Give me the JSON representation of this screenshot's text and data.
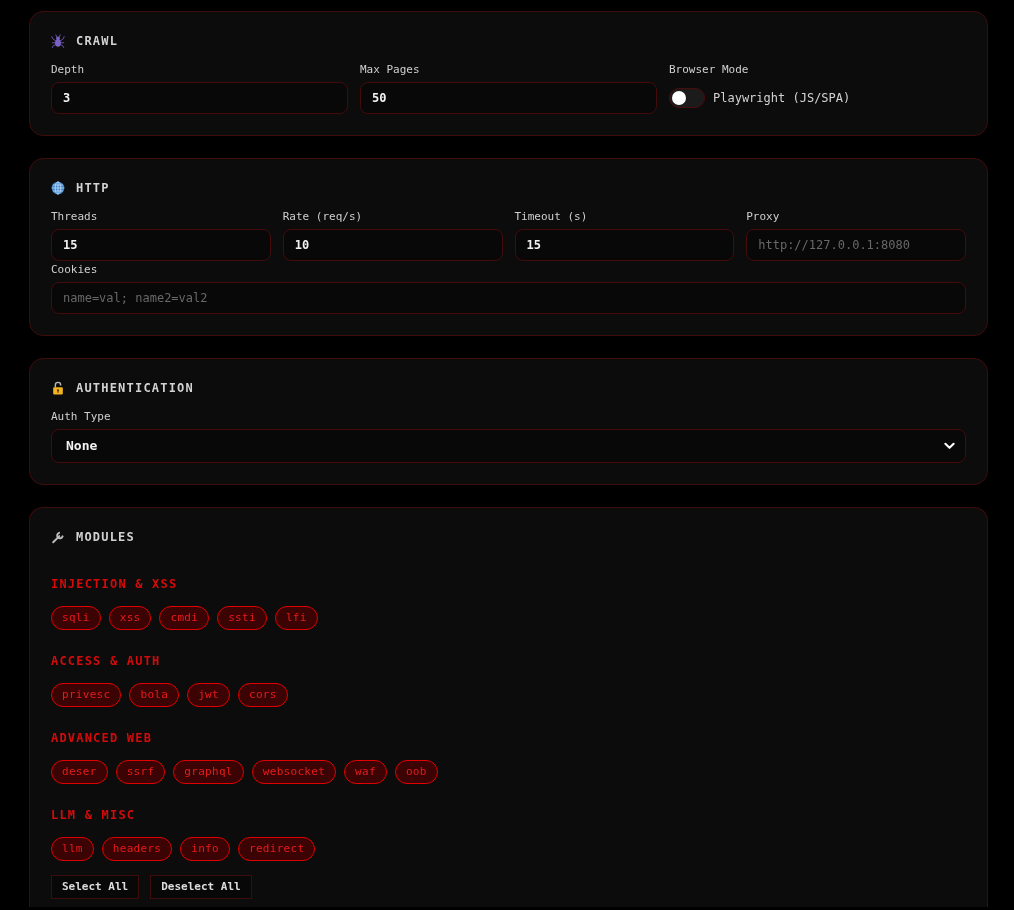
{
  "sections": [
    {
      "title": "CRAWL",
      "rows": [
        [
          {
            "kind": "input",
            "label": "Depth",
            "value": "3"
          },
          {
            "kind": "input",
            "label": "Max Pages",
            "value": "50"
          },
          {
            "kind": "toggle",
            "label": "Browser Mode",
            "text": "Playwright (JS/SPA)",
            "on": false
          }
        ]
      ]
    },
    {
      "title": "HTTP",
      "rows": [
        [
          {
            "kind": "input",
            "label": "Threads",
            "value": "15"
          },
          {
            "kind": "input",
            "label": "Rate (req/s)",
            "value": "10"
          },
          {
            "kind": "input",
            "label": "Timeout (s)",
            "value": "15"
          },
          {
            "kind": "input",
            "label": "Proxy",
            "placeholder": "http://127.0.0.1:8080"
          }
        ],
        [
          {
            "kind": "input",
            "label": "Cookies",
            "placeholder": "name=val; name2=val2"
          }
        ]
      ]
    },
    {
      "title": "AUTHENTICATION",
      "rows": [
        [
          {
            "kind": "select",
            "label": "Auth Type",
            "value": "None"
          }
        ]
      ]
    },
    {
      "title": "MODULES",
      "groups": [
        {
          "heading": "INJECTION & XSS",
          "modules": [
            {
              "label": "sqli",
              "selected": true
            },
            {
              "label": "xss",
              "selected": true
            },
            {
              "label": "cmdi",
              "selected": true
            },
            {
              "label": "ssti",
              "selected": true
            },
            {
              "label": "lfi",
              "selected": true
            }
          ]
        },
        {
          "heading": "ACCESS & AUTH",
          "modules": [
            {
              "label": "privesc",
              "selected": true
            },
            {
              "label": "bola",
              "selected": true
            },
            {
              "label": "jwt",
              "selected": true
            },
            {
              "label": "cors",
              "selected": true
            }
          ]
        },
        {
          "heading": "ADVANCED WEB",
          "modules": [
            {
              "label": "deser",
              "selected": true
            },
            {
              "label": "ssrf",
              "selected": true
            },
            {
              "label": "graphql",
              "selected": true
            },
            {
              "label": "websocket",
              "selected": true
            },
            {
              "label": "waf",
              "selected": true
            },
            {
              "label": "oob",
              "selected": true
            }
          ]
        },
        {
          "heading": "LLM & MISC",
          "modules": [
            {
              "label": "llm",
              "selected": true
            },
            {
              "label": "headers",
              "selected": true
            },
            {
              "label": "info",
              "selected": true
            },
            {
              "label": "redirect",
              "selected": true
            }
          ]
        }
      ],
      "buttons": [
        "Select All",
        "Deselect All"
      ]
    }
  ]
}
